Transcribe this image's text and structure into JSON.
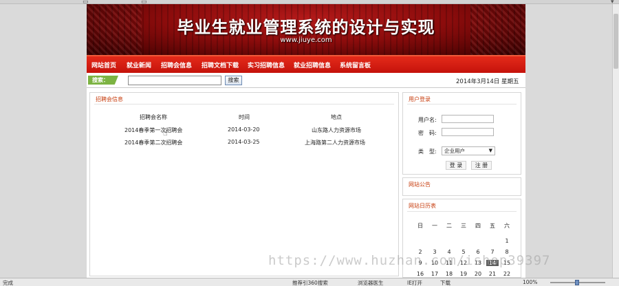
{
  "banner": {
    "title": "毕业生就业管理系统的设计与实现",
    "url": "www.jiuye.com"
  },
  "nav": {
    "items": [
      {
        "label": "网站首页"
      },
      {
        "label": "就业新闻"
      },
      {
        "label": "招聘会信息"
      },
      {
        "label": "招聘文档下载"
      },
      {
        "label": "实习招聘信息"
      },
      {
        "label": "就业招聘信息"
      },
      {
        "label": "系统留言板"
      }
    ]
  },
  "toolbar": {
    "search_label": "搜索：",
    "search_value": "",
    "search_button": "搜索",
    "date": "2014年3月14日 星期五"
  },
  "main": {
    "title": "招聘会信息",
    "columns": [
      "招聘会名称",
      "时间",
      "地点"
    ],
    "rows": [
      [
        "2014春季第一次招聘会",
        "2014-03-20",
        "山东路人力资源市场"
      ],
      [
        "2014春季第二次招聘会",
        "2014-03-25",
        "上海路第二人力资源市场"
      ]
    ]
  },
  "login": {
    "title": "用户登录",
    "username_label": "用户名:",
    "password_label": "密　码:",
    "type_label": "类　型:",
    "type_selected": "企业用户",
    "login_button": "登 录",
    "register_button": "注 册"
  },
  "notice": {
    "title": "网站公告"
  },
  "calendar": {
    "title": "网站日历表",
    "weekdays": [
      "日",
      "一",
      "二",
      "三",
      "四",
      "五",
      "六"
    ],
    "rows": [
      [
        "",
        "",
        "",
        "",
        "",
        "",
        "1"
      ],
      [
        "2",
        "3",
        "4",
        "5",
        "6",
        "7",
        "8"
      ],
      [
        "9",
        "10",
        "11",
        "12",
        "13",
        "14",
        "15"
      ],
      [
        "16",
        "17",
        "18",
        "19",
        "20",
        "21",
        "22"
      ]
    ],
    "today": "14"
  },
  "watermark": "https://www.huzhan.com/ishop39397",
  "statusbar": {
    "left": "完成",
    "items": [
      "推荐引360搜索",
      "浏览器医生",
      "IE打开",
      "下载"
    ],
    "zoom": "100%"
  },
  "colors": {
    "nav_red": "#d21d10",
    "accent_orange": "#c73d0e",
    "search_green": "#7cb342"
  }
}
